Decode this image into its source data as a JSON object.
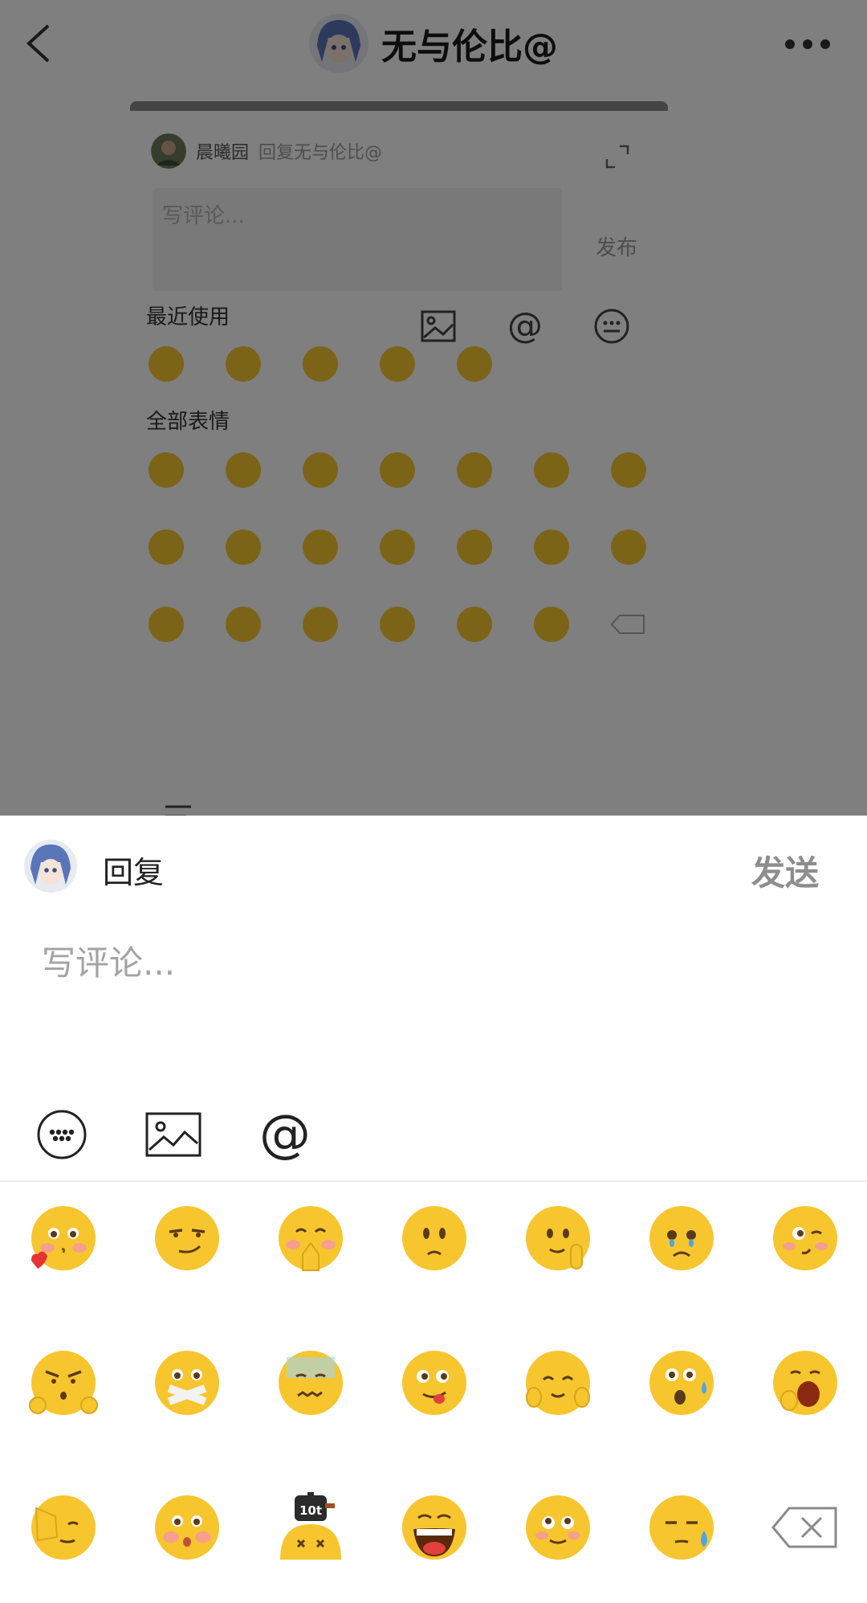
{
  "header": {
    "title": "无与伦比@",
    "back_icon": "back-arrow-icon",
    "more_icon": "more-dots-icon"
  },
  "background_card": {
    "user": "晨曦园",
    "reply_to": "回复无与伦比@",
    "placeholder": "写评论...",
    "post_label": "发布",
    "recent_label": "最近使用",
    "all_label": "全部表情"
  },
  "reply_panel": {
    "reply_label": "回复",
    "send_label": "发送",
    "placeholder": "写评论...",
    "tools": [
      "emoji-keyboard-icon",
      "image-icon",
      "at-icon"
    ]
  },
  "emoji_grid": {
    "rows": [
      [
        "heart-kiss-emoji",
        "smirk-emoji",
        "pray-blush-emoji",
        "thinking-emoji",
        "thumb-chin-emoji",
        "teary-emoji",
        "wink-emoji"
      ],
      [
        "angry-fists-emoji",
        "taped-mouth-emoji",
        "nervous-emoji",
        "tongue-out-emoji",
        "hands-cheeks-emoji",
        "shocked-sweat-emoji",
        "yawn-emoji"
      ],
      [
        "facepalm-emoji",
        "blushing-emoji",
        "heavy-weight-emoji",
        "big-laugh-emoji",
        "rolling-eyes-emoji",
        "cold-sweat-emoji",
        "delete-key-icon"
      ]
    ]
  },
  "colors": {
    "emoji_face": "#F7C62F",
    "send_disabled": "#8D8D8D",
    "overlay": "#000000"
  }
}
